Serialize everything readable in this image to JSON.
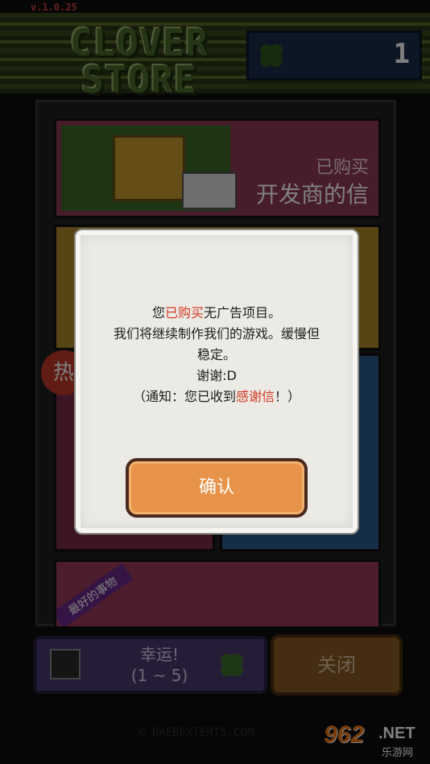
{
  "version": "v.1.0.25",
  "header": {
    "title_line1": "CLOVER",
    "title_line2": "STORE",
    "clover_count": "1"
  },
  "shop": {
    "item_letter": {
      "status": "已购买",
      "name": "开发商的信"
    },
    "hot_badge": "热",
    "bottom_item_ribbon": "最好的事物"
  },
  "buttons": {
    "luck_label": "幸运!",
    "luck_range": "(1 ~ 5)",
    "close": "关闭"
  },
  "credit": "© DAEBEXTERTS.COM",
  "watermark": {
    "num": "962",
    "net": ".NET",
    "cn": "乐游网"
  },
  "dialog": {
    "line1_pre": "您",
    "line1_red": "已购买",
    "line1_post": "无广告项目。",
    "line2": "我们将继续制作我们的游戏。缓慢但",
    "line3": "稳定。",
    "line4": "谢谢:D",
    "line5_pre": "（通知：您已收到",
    "line5_red": "感谢信",
    "line5_post": "！）",
    "confirm": "确认"
  },
  "colors": {
    "accent_red": "#d43a24",
    "confirm_orange": "#e7934a",
    "clover_green": "#4b6b2c"
  }
}
